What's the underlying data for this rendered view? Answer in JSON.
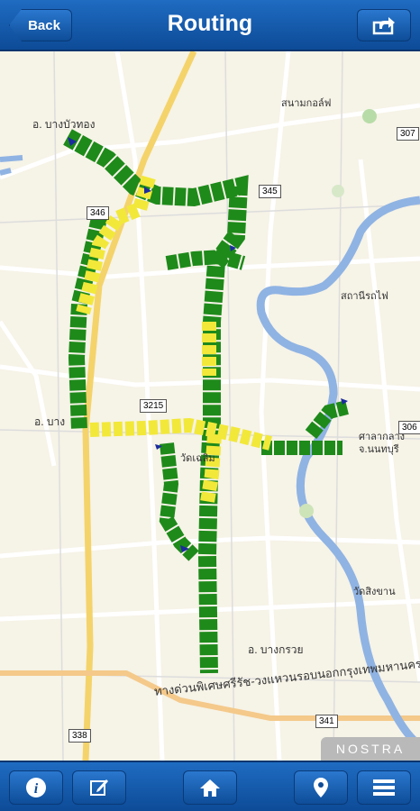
{
  "header": {
    "back_label": "Back",
    "title": "Routing",
    "share_icon": "share-icon"
  },
  "map": {
    "labels": {
      "bang_bua_thong": "อ. บางบัวทอง",
      "bang_yai": "อ. บาง",
      "bang_kruai": "อ. บางกรวย",
      "nonthaburi": "จ.นนทบุรี",
      "sala_klang": "ศาลากลาง",
      "wat_chalerm": "วัดเฉลิม",
      "wat_sikharan": "วัดสิงขาน",
      "top_right_place": "สนามกอล์ฟ",
      "right_mid_place": "สถานีรถไฟ",
      "expressway": "ทางด่วนพิเศษศรีรัช-วงแหวนรอบนอกกรุงเทพมหานคร"
    },
    "shields": {
      "r307": "307",
      "r345": "345",
      "r346": "346",
      "r3215": "3215",
      "r306": "306",
      "r341": "341",
      "r338": "338"
    },
    "watermark": "NOSTRA"
  },
  "footer": {
    "info_icon": "info-icon",
    "edit_icon": "edit-icon",
    "home_icon": "home-icon",
    "pin_icon": "location-pin-icon",
    "list_icon": "list-icon"
  },
  "colors": {
    "primary": "#1a5fb0",
    "route_green": "#1e8a1a",
    "route_yellow": "#f2e83a",
    "river": "#8fb3e3"
  }
}
